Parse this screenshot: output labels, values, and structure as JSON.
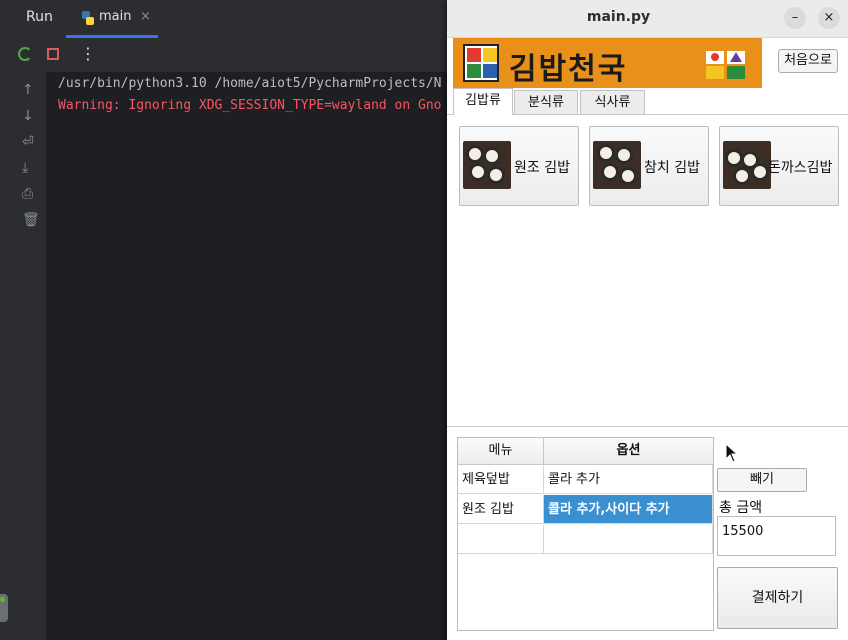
{
  "ide": {
    "run_label": "Run",
    "tab_label": "main",
    "tab_close": "×",
    "more_label": "⋮",
    "console": {
      "line1": "/usr/bin/python3.10 /home/aiot5/PycharmProjects/N",
      "line2": "Warning: Ignoring XDG_SESSION_TYPE=wayland on Gno"
    }
  },
  "window": {
    "title": "main.py",
    "minimize": "–",
    "close": "×"
  },
  "logo": {
    "text": "김밥천국"
  },
  "home_button": "처음으로",
  "tabs": [
    {
      "label": "김밥류",
      "active": true
    },
    {
      "label": "분식류",
      "active": false
    },
    {
      "label": "식사류",
      "active": false
    }
  ],
  "menu_items": [
    {
      "label": "원조 김밥"
    },
    {
      "label": "참치 김밥"
    },
    {
      "label": "돈까스김밥"
    }
  ],
  "order_table": {
    "headers": [
      "메뉴",
      "옵션"
    ],
    "rows": [
      {
        "menu": "제육덮밥",
        "option": "콜라 추가"
      },
      {
        "menu": "원조 김밥",
        "option": "콜라 추가,사이다 추가"
      },
      {
        "menu": "",
        "option": ""
      }
    ]
  },
  "delete_button": "빼기",
  "total_label": "총 금액",
  "total_value": "15500",
  "pay_button": "결제하기",
  "colors": {
    "logo_bg": "#e8901a",
    "selected_row": "#3a8fd1",
    "warning_text": "#f75464"
  }
}
